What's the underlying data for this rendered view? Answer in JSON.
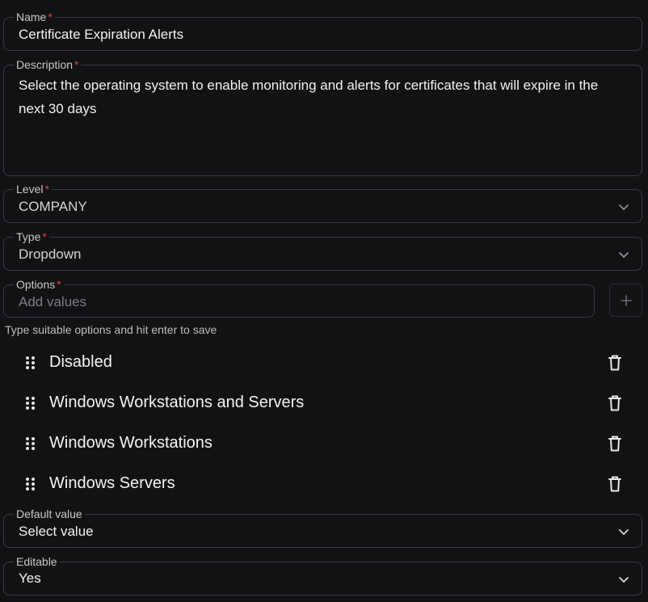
{
  "form": {
    "name": {
      "label": "Name",
      "required_mark": "*",
      "value": "Certificate Expiration Alerts"
    },
    "description": {
      "label": "Description",
      "required_mark": "*",
      "value": "Select the operating system to enable monitoring and alerts for certificates that will expire in the next 30 days"
    },
    "level": {
      "label": "Level",
      "required_mark": "*",
      "value": "COMPANY"
    },
    "type": {
      "label": "Type",
      "required_mark": "*",
      "value": "Dropdown"
    },
    "options": {
      "label": "Options",
      "required_mark": "*",
      "placeholder": "Add values",
      "hint": "Type suitable options and hit enter to save",
      "items": [
        "Disabled",
        "Windows Workstations and Servers",
        "Windows Workstations",
        "Windows Servers"
      ]
    },
    "default_value": {
      "label": "Default value",
      "value": "Select value"
    },
    "editable": {
      "label": "Editable",
      "value": "Yes"
    }
  },
  "icons": {
    "chevron": "chevron-down-icon",
    "plus": "plus-icon",
    "grip": "drag-handle-icon",
    "trash": "trash-icon"
  },
  "colors": {
    "background": "#111214",
    "border": "#3a3b3f",
    "required": "#e0454b",
    "text": "#f2f2f2"
  }
}
